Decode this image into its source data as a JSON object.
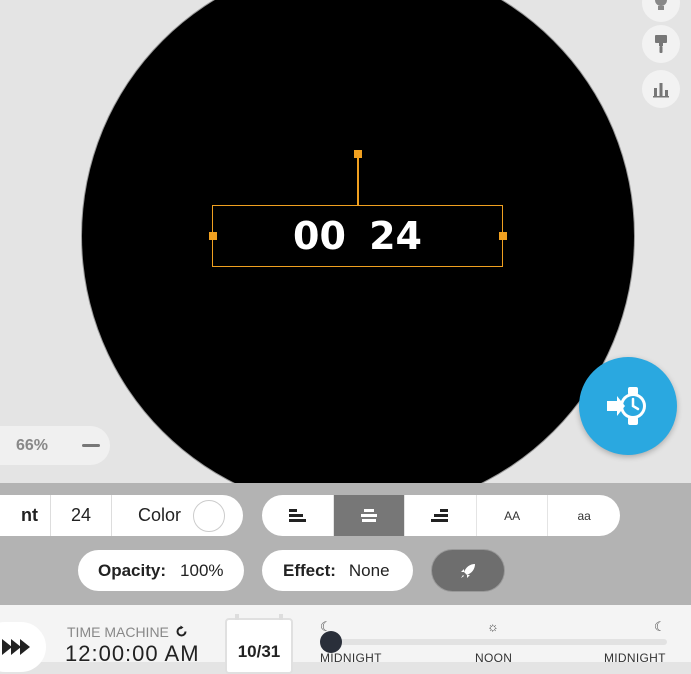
{
  "watch": {
    "time_display": "00 24"
  },
  "canvas": {
    "zoom_value": "66%",
    "side_icons": [
      "bulb-icon",
      "paint-roller-icon",
      "bar-chart-icon"
    ],
    "fab_icon": "watch-sync-icon"
  },
  "toolbar": {
    "font_label": "nt",
    "font_size": "24",
    "color_label": "Color",
    "color_value": "#ffffff",
    "align_buttons": [
      "align-left-icon",
      "align-center-icon",
      "align-right-icon"
    ],
    "case_upper": "AA",
    "case_lower": "aa",
    "opacity_label": "Opacity:",
    "opacity_value": "100%",
    "effect_label": "Effect:",
    "effect_value": "None",
    "rocket_icon": "rocket-icon"
  },
  "time_machine": {
    "label": "TIME MACHINE",
    "time": "12:00:00 AM",
    "date": "10/31",
    "slider_position": 0,
    "ticks": [
      {
        "label": "MIDNIGHT",
        "icon": "moon-icon"
      },
      {
        "label": "NOON",
        "icon": "sun-icon"
      },
      {
        "label": "MIDNIGHT",
        "icon": "moon-icon"
      }
    ]
  },
  "colors": {
    "accent": "#f0a020",
    "fab": "#2aa8e0",
    "face": "#000000"
  }
}
